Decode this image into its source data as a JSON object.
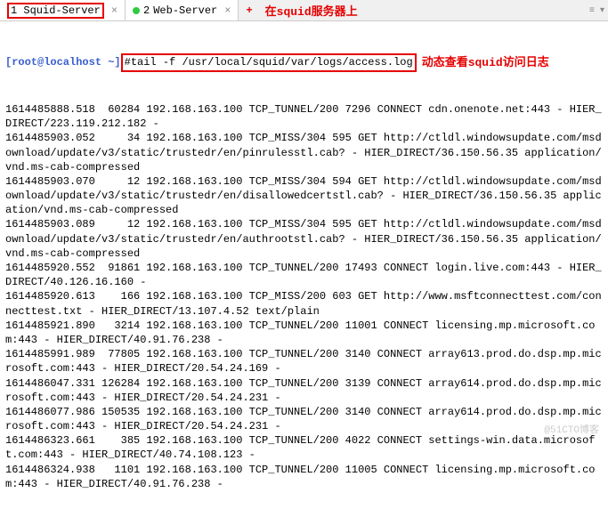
{
  "tabs": [
    {
      "index": "1",
      "label": "Squid-Server",
      "active": true
    },
    {
      "index": "2",
      "label": "Web-Server",
      "active": false
    }
  ],
  "annotations": {
    "tab_note": "在squid服务器上",
    "cmd_note": "动态查看squid访问日志"
  },
  "prompt": "[root@localhost ~]",
  "prompt_hash": "#",
  "command": "tail -f /usr/local/squid/var/logs/access.log",
  "log_lines": [
    "1614485888.518  60284 192.168.163.100 TCP_TUNNEL/200 7296 CONNECT cdn.onenote.net:443 - HIER_DIRECT/223.119.212.182 -",
    "1614485903.052     34 192.168.163.100 TCP_MISS/304 595 GET http://ctldl.windowsupdate.com/msdownload/update/v3/static/trustedr/en/pinrulesstl.cab? - HIER_DIRECT/36.150.56.35 application/vnd.ms-cab-compressed",
    "1614485903.070     12 192.168.163.100 TCP_MISS/304 594 GET http://ctldl.windowsupdate.com/msdownload/update/v3/static/trustedr/en/disallowedcertstl.cab? - HIER_DIRECT/36.150.56.35 application/vnd.ms-cab-compressed",
    "1614485903.089     12 192.168.163.100 TCP_MISS/304 595 GET http://ctldl.windowsupdate.com/msdownload/update/v3/static/trustedr/en/authrootstl.cab? - HIER_DIRECT/36.150.56.35 application/vnd.ms-cab-compressed",
    "1614485920.552  91861 192.168.163.100 TCP_TUNNEL/200 17493 CONNECT login.live.com:443 - HIER_DIRECT/40.126.16.160 -",
    "1614485920.613    166 192.168.163.100 TCP_MISS/200 603 GET http://www.msftconnecttest.com/connecttest.txt - HIER_DIRECT/13.107.4.52 text/plain",
    "1614485921.890   3214 192.168.163.100 TCP_TUNNEL/200 11001 CONNECT licensing.mp.microsoft.com:443 - HIER_DIRECT/40.91.76.238 -",
    "1614485991.989  77805 192.168.163.100 TCP_TUNNEL/200 3140 CONNECT array613.prod.do.dsp.mp.microsoft.com:443 - HIER_DIRECT/20.54.24.169 -",
    "1614486047.331 126284 192.168.163.100 TCP_TUNNEL/200 3139 CONNECT array614.prod.do.dsp.mp.microsoft.com:443 - HIER_DIRECT/20.54.24.231 -",
    "1614486077.986 150535 192.168.163.100 TCP_TUNNEL/200 3140 CONNECT array614.prod.do.dsp.mp.microsoft.com:443 - HIER_DIRECT/20.54.24.231 -",
    "1614486323.661    385 192.168.163.100 TCP_TUNNEL/200 4022 CONNECT settings-win.data.microsoft.com:443 - HIER_DIRECT/40.74.108.123 -",
    "1614486324.938   1101 192.168.163.100 TCP_TUNNEL/200 11005 CONNECT licensing.mp.microsoft.com:443 - HIER_DIRECT/40.91.76.238 -"
  ],
  "watermark": "@51CTO博客"
}
